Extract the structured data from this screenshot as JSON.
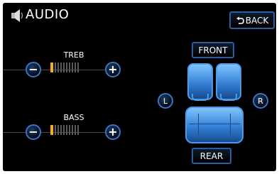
{
  "header": {
    "title": "AUDIO",
    "back_label": "BACK",
    "back_icon": "return-arrow-icon",
    "speaker_icon": "speaker-icon"
  },
  "treble": {
    "label": "TREB",
    "minus": "−",
    "plus": "+",
    "level": 1,
    "segments": 10
  },
  "bass": {
    "label": "BASS",
    "minus": "−",
    "plus": "+",
    "level": 1,
    "segments": 10
  },
  "balance": {
    "front_label": "FRONT",
    "rear_label": "REAR",
    "left_label": "L",
    "right_label": "R"
  },
  "colors": {
    "accent": "#3a74c8",
    "level": "#f0b020",
    "seat": "#4a9ae8"
  }
}
